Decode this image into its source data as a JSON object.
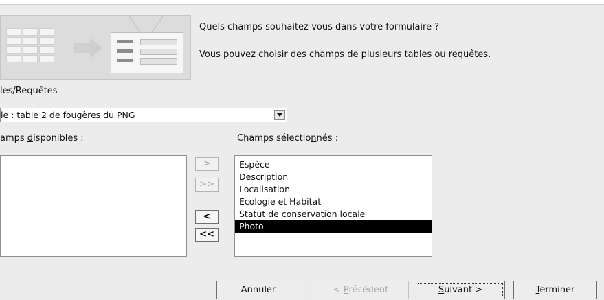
{
  "header": {
    "question": "Quels champs souhaitez-vous dans votre formulaire ?",
    "subtext": "Vous pouvez choisir des champs de plusieurs tables ou requêtes."
  },
  "tables": {
    "label": "les/Requêtes",
    "selected": "le : table 2 de fougères du PNG"
  },
  "available": {
    "label_pre": "amps ",
    "label_u": "d",
    "label_post": "isponibles :",
    "items": []
  },
  "selected_fields": {
    "label_pre": "Champs sélectio",
    "label_u": "n",
    "label_post": "nés :",
    "items": [
      "Espèce",
      "Description",
      "Localisation",
      "Ecologie et Habitat",
      "Statut de conservation locale",
      "Photo"
    ],
    "highlighted": "Photo"
  },
  "movers": {
    "add_one": ">",
    "add_all": ">>",
    "remove_one": "<",
    "remove_all": "<<"
  },
  "buttons": {
    "cancel": "Annuler",
    "prev_pre": "< ",
    "prev_u": "P",
    "prev_post": "récédent",
    "next_u": "S",
    "next_post": "uivant >",
    "finish_u": "T",
    "finish_post": "erminer"
  }
}
